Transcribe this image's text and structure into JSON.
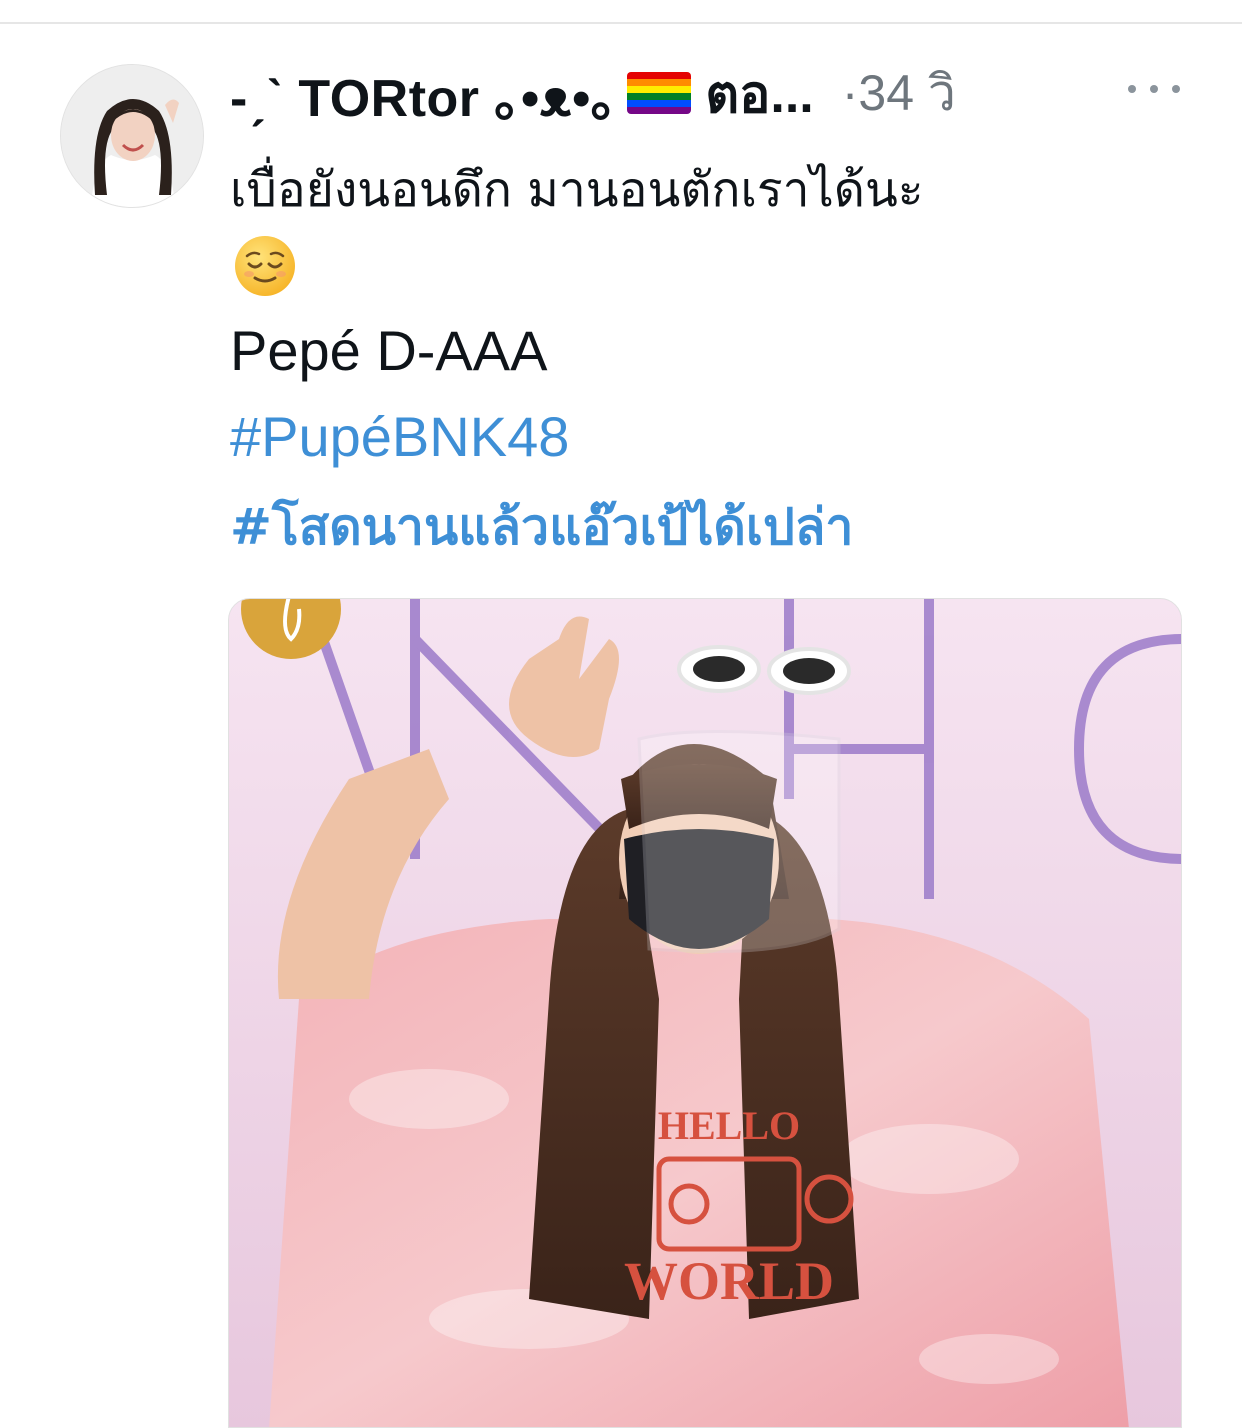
{
  "tweet": {
    "author": {
      "display_name": "-ˏˋ TORtor ｡•ᴥ•｡",
      "display_name_suffix": "ตอ...",
      "avatar_icon": "profile-avatar",
      "flag_icon": "rainbow-flag-icon"
    },
    "timestamp": "·34 วิ",
    "more_icon": "more-horizontal-icon",
    "text_line_1": "เบื่อยังนอนดึก มานอนตักเราได้นะ",
    "emoji": "relieved-face-emoji",
    "text_line_2": "Pepé D-AAA",
    "hashtags": [
      "#PupéBNK48",
      "#โสดนานแล้วแอ๊วเป้ได้เปล่า"
    ],
    "media": {
      "type": "photo",
      "shirt_text": [
        "HELLO",
        "WORLD"
      ]
    }
  },
  "colors": {
    "text": "#0f1419",
    "secondary": "#6e767d",
    "link": "#3e8fd6",
    "rainbow": [
      "#e40303",
      "#ff8c00",
      "#ffed00",
      "#008026",
      "#004dff",
      "#750787"
    ]
  }
}
